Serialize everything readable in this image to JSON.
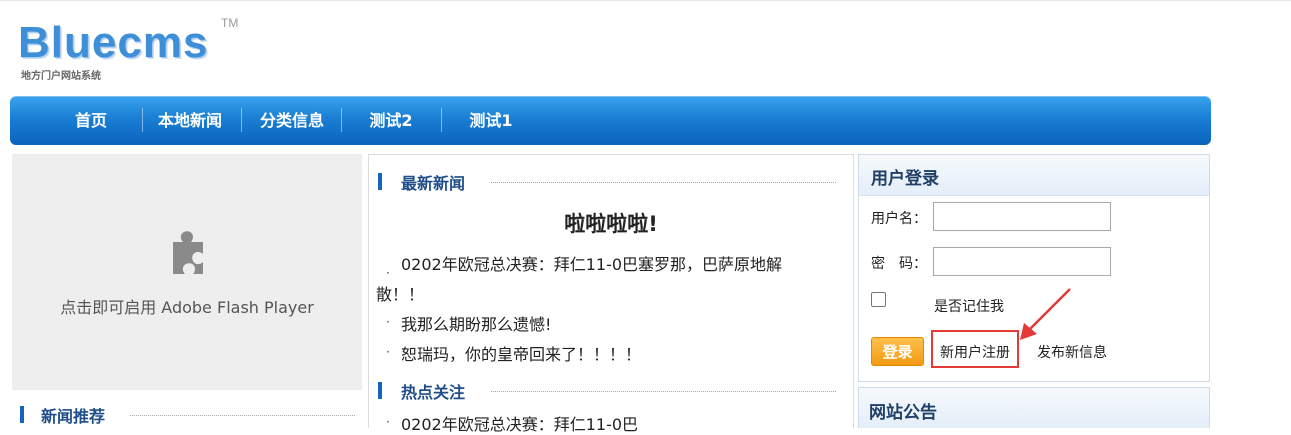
{
  "logo": {
    "brand": "Bluecms",
    "tm": "TM",
    "subtitle": "地方门户网站系统"
  },
  "nav": {
    "items": [
      "首页",
      "本地新闻",
      "分类信息",
      "测试2",
      "测试1"
    ]
  },
  "flash": {
    "message": "点击即可启用 Adobe Flash Player",
    "icon": "puzzle-piece-icon"
  },
  "left": {
    "section_title": "新闻推荐"
  },
  "middle": {
    "latest_title": "最新新闻",
    "headline": "啦啦啦啦!",
    "news": [
      "0202年欧冠总决赛：拜仁11-0巴塞罗那，巴萨原地解",
      "散！！",
      "我那么期盼那么遗憾!",
      "恕瑞玛，你的皇帝回来了！！！！"
    ],
    "hot_title": "热点关注",
    "hot_news": [
      "0202年欧冠总决赛：拜仁11-0巴"
    ],
    "bullet": "·"
  },
  "login": {
    "title": "用户登录",
    "username_label": "用户名：",
    "password_label": "密　码：",
    "username_value": "",
    "password_value": "",
    "remember_label": "是否记住我",
    "remember_checked": false,
    "login_button": "登录",
    "register_link": "新用户注册",
    "post_link": "发布新信息"
  },
  "notice": {
    "title": "网站公告"
  },
  "colors": {
    "nav": "#1a7fd4",
    "accent": "#f39a12",
    "highlight": "#e53935",
    "title": "#1f4e89"
  }
}
